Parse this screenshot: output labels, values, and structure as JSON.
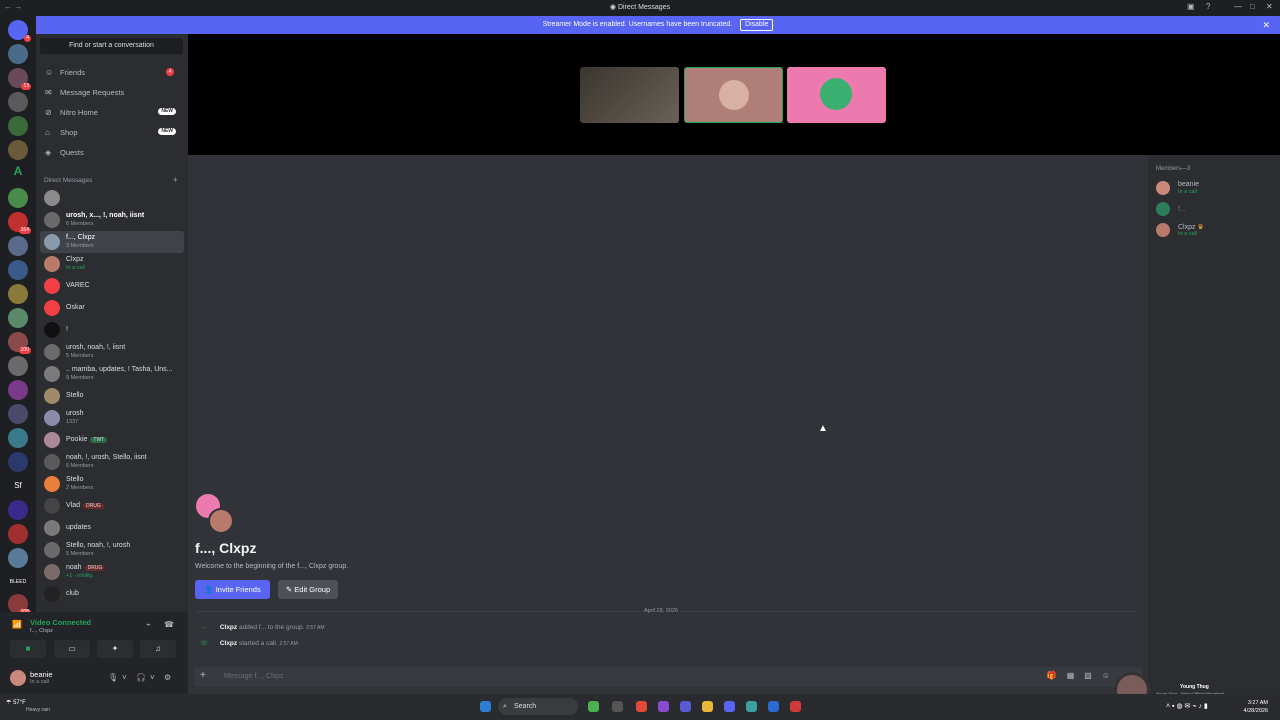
{
  "window": {
    "title": "Direct Messages"
  },
  "banner": {
    "text": "Streamer Mode is enabled. Usernames have been truncated.",
    "disable_label": "Disable"
  },
  "sidebar": {
    "find_label": "Find or start a conversation",
    "nav": [
      {
        "label": "Friends",
        "icon": "friends-icon",
        "count": "4"
      },
      {
        "label": "Message Requests",
        "icon": "message-requests-icon"
      },
      {
        "label": "Nitro Home",
        "icon": "nitro-icon",
        "pill": "NEW"
      },
      {
        "label": "Shop",
        "icon": "shop-icon",
        "pill": "NEW"
      },
      {
        "label": "Quests",
        "icon": "quests-icon"
      }
    ],
    "dm_header": "Direct Messages",
    "dms": [
      {
        "name": "",
        "sub": ""
      },
      {
        "name": "urosh, x..., !, noah, iisnt",
        "sub": "6 Members"
      },
      {
        "name": "f..., Clxpz",
        "sub": "3 Members"
      },
      {
        "name": "Clxpz",
        "sub": "In a call"
      },
      {
        "name": "VAREC",
        "sub": ""
      },
      {
        "name": "Oskar",
        "sub": ""
      },
      {
        "name": "!",
        "sub": ""
      },
      {
        "name": "urosh, noah, !, iisnt",
        "sub": "5 Members"
      },
      {
        "name": ".. mamba, updates, ! Tasha, Uns...",
        "sub": "9 Members"
      },
      {
        "name": "Stello",
        "sub": ""
      },
      {
        "name": "urosh",
        "sub": "1337"
      },
      {
        "name": "Pookie",
        "sub": "",
        "tag": "TWT"
      },
      {
        "name": "noah, !, urosh, Stello, iisnt",
        "sub": "6 Members"
      },
      {
        "name": "Stello",
        "sub": "2 Members"
      },
      {
        "name": "Vlad",
        "sub": "",
        "tag": "DRUG"
      },
      {
        "name": "updates",
        "sub": ""
      },
      {
        "name": "Stello, noah, !, urosh",
        "sub": "5 Members"
      },
      {
        "name": "noah",
        "sub": "+1 · nihility.",
        "tag": "DRUG"
      },
      {
        "name": "club",
        "sub": ""
      }
    ]
  },
  "voice": {
    "status": "Video Connected",
    "channel": "f..., Clxpz"
  },
  "user": {
    "name": "beanie",
    "status": "In a call"
  },
  "members": {
    "header": "Members—3",
    "list": [
      {
        "name": "beanie",
        "sub": "In a call",
        "color": "#c98a7c"
      },
      {
        "name": "f...",
        "sub": "",
        "color": "#2e7d5a"
      },
      {
        "name": "Clxpz",
        "sub": "In a call",
        "color": "#b87a6a"
      }
    ]
  },
  "chat": {
    "title": "f..., Clxpz",
    "desc": "Welcome to the beginning of the f..., Clxpz group.",
    "invite_label": "Invite Friends",
    "edit_label": "Edit Group",
    "date": "April 28, 2026",
    "messages": [
      {
        "user": "Clxpz",
        "text": "added f... to the group.",
        "time": "2:57 AM",
        "icon": "arrow-right-icon"
      },
      {
        "user": "Clxpz",
        "text": "started a call.",
        "time": "2:57 AM",
        "icon": "phone-icon"
      }
    ],
    "placeholder": "Message f..., Clxpz"
  },
  "music": {
    "artist": "Young Thug",
    "track": "Young Thug - Ninja (Official Visualizer)"
  },
  "taskbar": {
    "temp": "57°F",
    "weather": "Heavy rain",
    "search_label": "Search",
    "time": "3:27 AM",
    "date": "4/28/2026"
  },
  "colors": {
    "accent": "#5865f2",
    "online": "#23a55a",
    "danger": "#f23f43"
  }
}
